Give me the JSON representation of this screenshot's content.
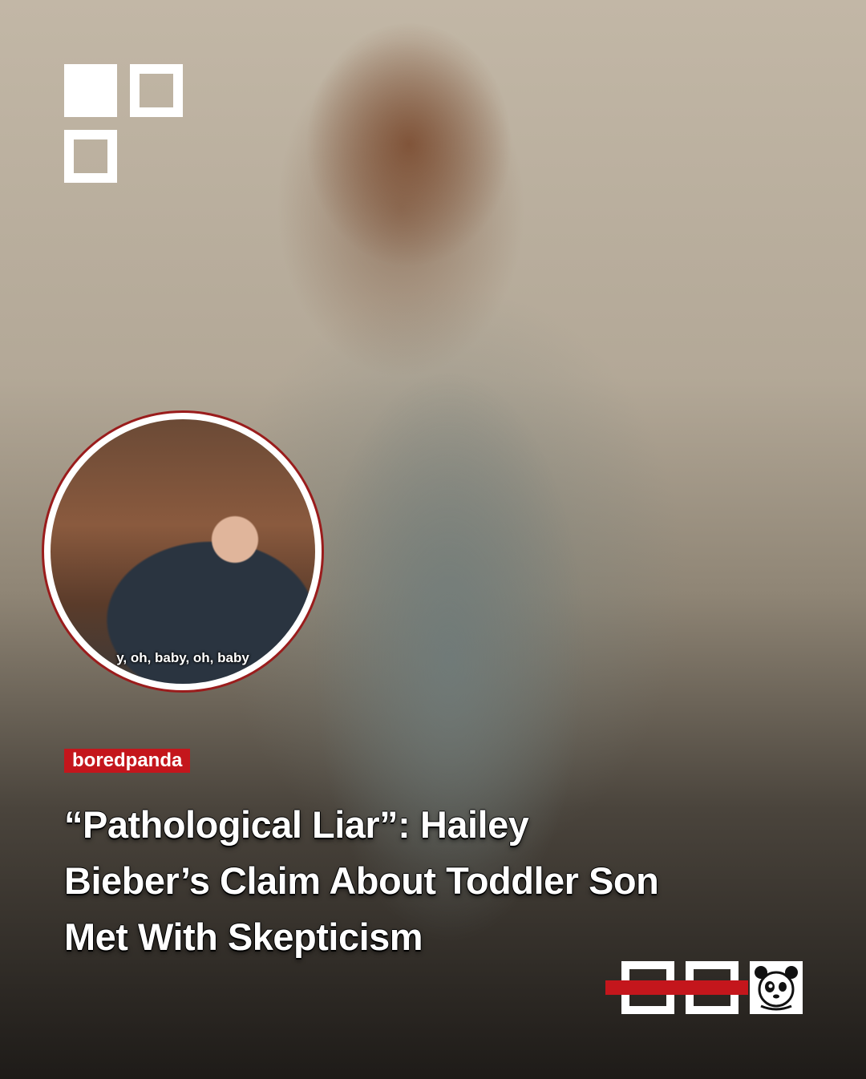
{
  "logo": {
    "icon": "squares-logo-icon"
  },
  "inset": {
    "caption": "y, oh, baby, oh, baby"
  },
  "brand": {
    "label": "boredpanda"
  },
  "headline": {
    "line1": "“Pathological Liar”: Hailey",
    "line2": "Bieber’s Claim About Toddler Son",
    "line3": "Met With Skepticism"
  },
  "badges": {
    "icon": "panda-icon",
    "accent_color": "#c4161c"
  }
}
